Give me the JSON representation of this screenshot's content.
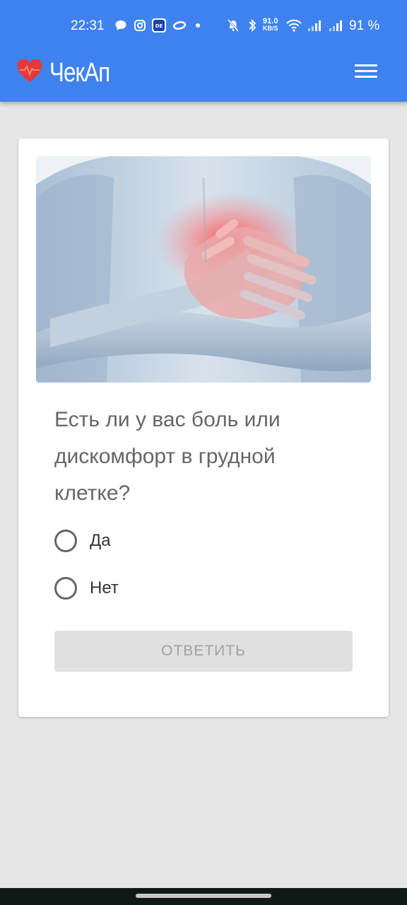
{
  "status_bar": {
    "time": "22:31",
    "net_speed_value": "91.0",
    "net_speed_unit": "KB/S",
    "battery": "91 %",
    "icons": [
      "chat-bubble-icon",
      "instagram-icon",
      "de-app-icon",
      "oval-app-icon",
      "dot-icon",
      "mute-icon",
      "bluetooth-icon",
      "wifi-icon",
      "signal-icon",
      "signal-icon-2"
    ]
  },
  "app_bar": {
    "title": "ЧекАп",
    "logo_icon": "heart-pulse-icon",
    "menu_icon": "hamburger-menu-icon"
  },
  "card": {
    "image_description_icon": "chest-pain-photo",
    "question": "Есть ли у вас боль или дискомфорт в грудной клетке?",
    "options": [
      {
        "label": "Да",
        "selected": false
      },
      {
        "label": "Нет",
        "selected": false
      }
    ],
    "submit_label": "ОТВЕТИТЬ",
    "submit_enabled": false
  },
  "colors": {
    "primary": "#3f82ef",
    "background": "#e7e7e7",
    "logo_red": "#e53935"
  }
}
